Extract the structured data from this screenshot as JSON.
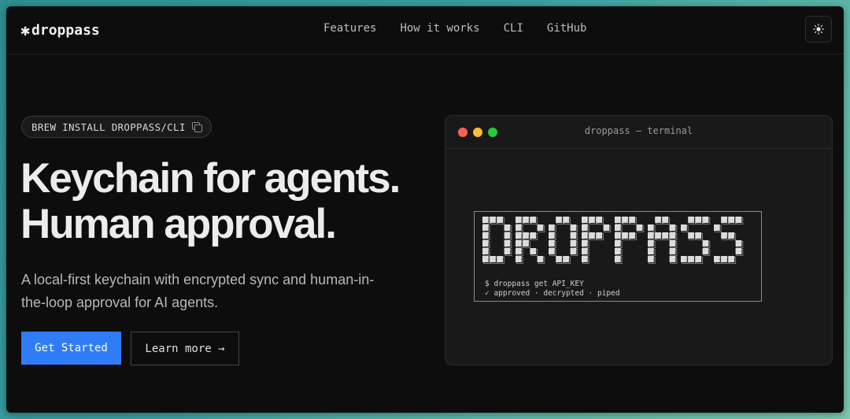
{
  "brand": {
    "logo_star": "✱",
    "logo_text": "droppass"
  },
  "nav": {
    "links": [
      "Features",
      "How it works",
      "CLI",
      "GitHub"
    ],
    "theme_icon": "sun-icon"
  },
  "hero": {
    "install_badge": "BREW INSTALL DROPPASS/CLI",
    "headline_1": "Keychain for agents.",
    "headline_2": "Human approval.",
    "subtext": "A local-first keychain with encrypted sync and human-in-the-loop approval for AI agents.",
    "primary_button": "Get Started",
    "secondary_button": "Learn more →"
  },
  "terminal": {
    "title": "droppass — terminal",
    "ascii_art": "DROPPASS",
    "lines": [
      "$ droppass get API_KEY",
      "✓ approved · decrypted · piped"
    ],
    "colors": {
      "close": "#ff5f57",
      "minimize": "#febc2e",
      "zoom": "#28c840"
    }
  },
  "colors": {
    "accent": "#2f7cf6",
    "background": "#0d0d0d"
  }
}
